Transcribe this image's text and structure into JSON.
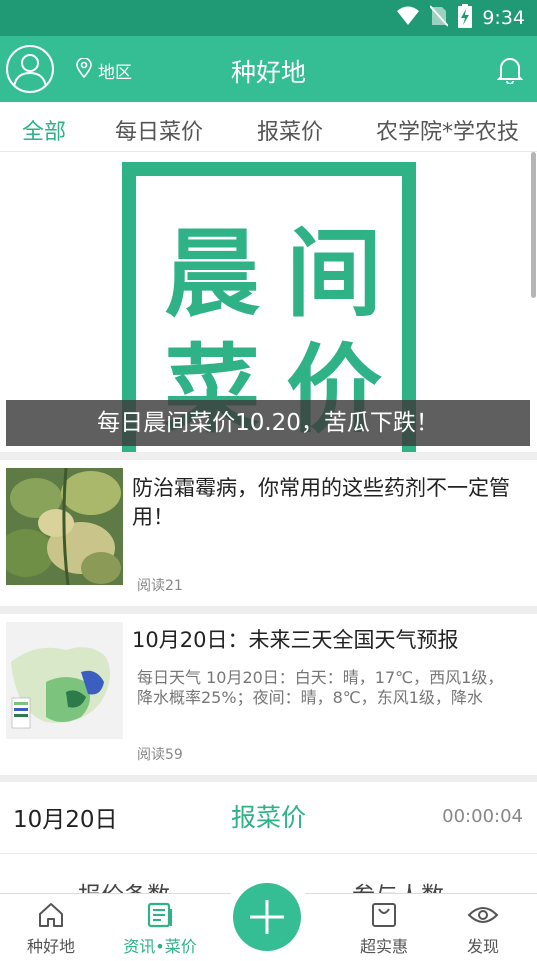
{
  "status_bar": {
    "time": "9:34",
    "icons": [
      "wifi-icon",
      "no-sim-icon",
      "battery-charging-icon"
    ]
  },
  "header": {
    "title": "种好地",
    "region_label": "地区",
    "icons": {
      "avatar": "user-avatar-icon",
      "region": "location-pin-icon",
      "notifications": "bell-icon"
    },
    "color": "#35be93"
  },
  "tabs": [
    {
      "label": "全部",
      "active": true
    },
    {
      "label": "每日菜价",
      "active": false
    },
    {
      "label": "报菜价",
      "active": false
    },
    {
      "label": "农学院*学农技",
      "active": false
    }
  ],
  "banner": {
    "chars": [
      "晨",
      "间",
      "菜",
      "价"
    ],
    "caption": "每日晨间菜价10.20，苦瓜下跌！"
  },
  "news": [
    {
      "title": "防治霜霉病，你常用的这些药剂不一定管用！",
      "reads": "阅读21"
    },
    {
      "title": "10月20日：未来三天全国天气预报",
      "desc": "每日天气 10月20日：白天：晴，17℃，西风1级，降水概率25%；夜间：晴，8℃，东风1级，降水",
      "reads": "阅读59"
    }
  ],
  "report": {
    "date": "10月20日",
    "title": "报菜价",
    "timer": "00:00:04",
    "stat_left": "报价条数",
    "stat_right": "参与人数"
  },
  "bottom_nav": [
    {
      "label": "种好地",
      "icon": "home-icon",
      "active": false
    },
    {
      "label": "资讯•菜价",
      "icon": "news-icon",
      "active": true
    },
    {
      "label": "",
      "icon": "plus-icon",
      "active": false
    },
    {
      "label": "超实惠",
      "icon": "shopping-bag-icon",
      "active": false
    },
    {
      "label": "发现",
      "icon": "eye-icon",
      "active": false
    }
  ],
  "colors": {
    "accent": "#35be93",
    "accent_text": "#2eb286",
    "status_bar": "#1f9a74"
  }
}
